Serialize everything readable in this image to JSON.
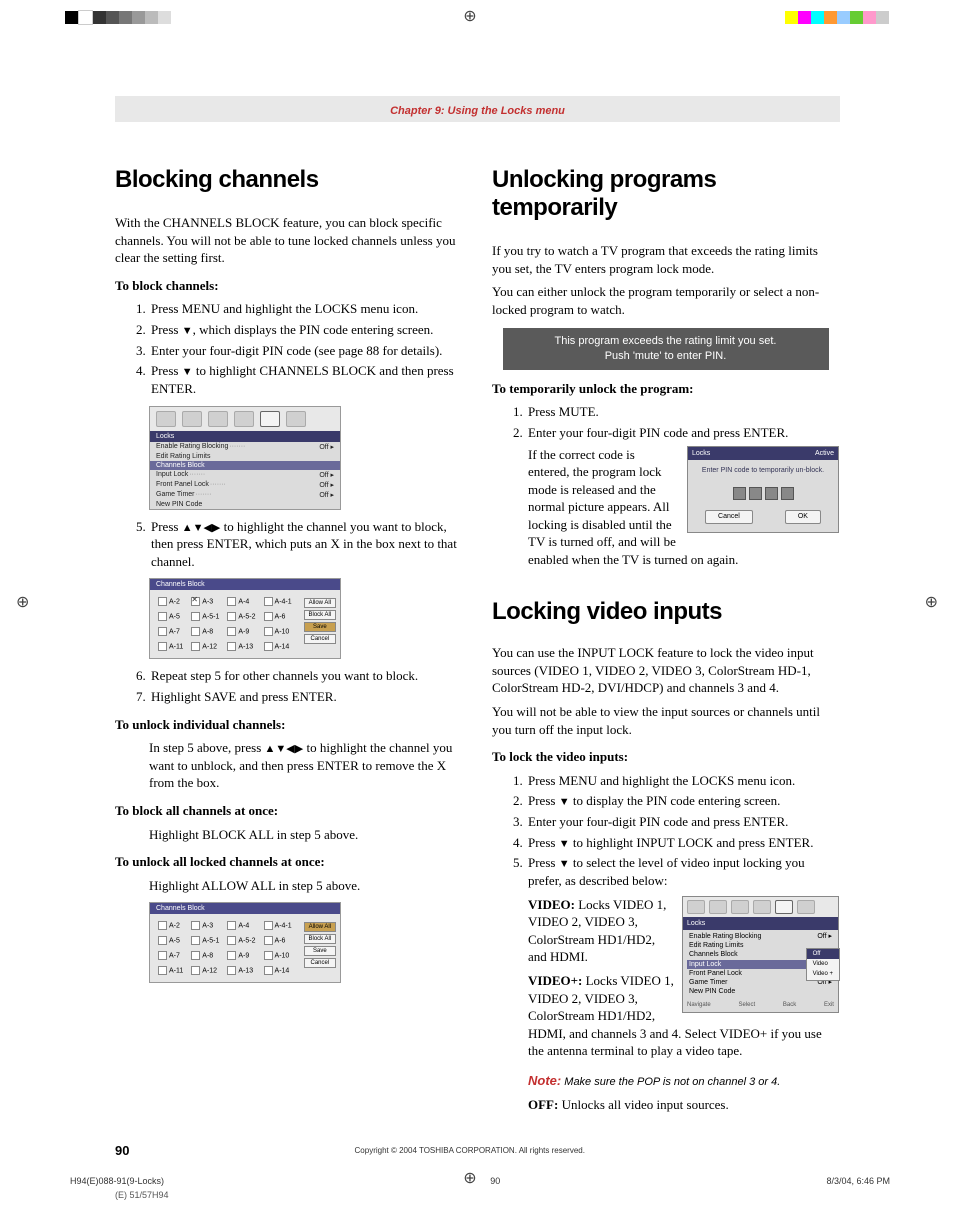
{
  "chapter": "Chapter 9: Using the Locks menu",
  "pageNumber": "90",
  "copyright": "Copyright © 2004 TOSHIBA CORPORATION. All rights reserved.",
  "printMeta": {
    "file": "H94(E)088-91(9-Locks)",
    "page": "90",
    "datetime": "8/3/04, 6:46 PM"
  },
  "trimLabel": "(E) 51/57H94",
  "left": {
    "h1": "Blocking channels",
    "intro": "With the CHANNELS BLOCK feature, you can block specific channels. You will not be able to tune locked channels unless you clear the setting first.",
    "blockHead": "To block channels:",
    "steps": {
      "s1": "Press MENU and highlight the LOCKS menu icon.",
      "s2a": "Press ",
      "s2b": ", which displays the PIN code entering screen.",
      "s3": "Enter your four-digit PIN code (see page 88 for details).",
      "s4a": "Press ",
      "s4b": " to highlight CHANNELS BLOCK and then press ENTER.",
      "s5a": "Press ",
      "s5b": " to highlight the channel you want to block, then press ENTER, which puts an X in the box next to that channel.",
      "s6": "Repeat step 5 for other channels you want to block.",
      "s7": "Highlight SAVE and press ENTER."
    },
    "unlockIndHead": "To unlock individual channels:",
    "unlockIndBody1": "In step 5 above, press ",
    "unlockIndBody2": " to highlight the channel you want to unblock, and then press ENTER to remove the X from the box.",
    "blockAllHead": "To block all channels at once:",
    "blockAllBody": "Highlight BLOCK ALL in step 5 above.",
    "unlockAllHead": "To unlock all locked channels at once:",
    "unlockAllBody": "Highlight ALLOW ALL in step 5 above.",
    "menuShot": {
      "title": "Locks",
      "rows": {
        "r1": {
          "label": "Enable Rating Blocking",
          "val": "Off ▸"
        },
        "r2": {
          "label": "Edit Rating Limits",
          "val": ""
        },
        "r3": {
          "label": "Channels Block",
          "val": ""
        },
        "r4": {
          "label": "Input Lock",
          "val": "Off ▸"
        },
        "r5": {
          "label": "Front Panel Lock",
          "val": "Off ▸"
        },
        "r6": {
          "label": "Game Timer",
          "val": "Off ▸"
        },
        "r7": {
          "label": "New PIN Code",
          "val": ""
        }
      }
    },
    "cb1": {
      "title": "Channels Block",
      "btns": {
        "allow": "Allow All",
        "block": "Block All",
        "save": "Save",
        "cancel": "Cancel"
      },
      "cells": {
        "r1c1": "A-2",
        "r1c2": "A-3",
        "r1c3": "A-4",
        "r1c4": "A-4-1",
        "r2c1": "A-5",
        "r2c2": "A-5-1",
        "r2c3": "A-5-2",
        "r2c4": "A-6",
        "r3c1": "A-7",
        "r3c2": "A-8",
        "r3c3": "A-9",
        "r3c4": "A-10",
        "r4c1": "A-11",
        "r4c2": "A-12",
        "r4c3": "A-13",
        "r4c4": "A-14"
      },
      "hl": "save"
    },
    "cb2": {
      "title": "Channels Block",
      "btns": {
        "allow": "Allow All",
        "block": "Block All",
        "save": "Save",
        "cancel": "Cancel"
      },
      "cells": {
        "r1c1": "A-2",
        "r1c2": "A-3",
        "r1c3": "A-4",
        "r1c4": "A-4-1",
        "r2c1": "A-5",
        "r2c2": "A-5-1",
        "r2c3": "A-5-2",
        "r2c4": "A-6",
        "r3c1": "A-7",
        "r3c2": "A-8",
        "r3c3": "A-9",
        "r3c4": "A-10",
        "r4c1": "A-11",
        "r4c2": "A-12",
        "r4c3": "A-13",
        "r4c4": "A-14"
      },
      "hl": "allow"
    }
  },
  "right": {
    "h1": "Unlocking programs temporarily",
    "intro1": "If you try to watch a TV program that exceeds the rating limits you set, the TV enters program lock mode.",
    "intro2": "You can either unlock the program temporarily or select a non-locked program to watch.",
    "msg1": "This program exceeds the rating limit you set.",
    "msg2": "Push 'mute' to enter PIN.",
    "tempHead": "To temporarily unlock the program:",
    "t1": "Press MUTE.",
    "t2": "Enter your four-digit PIN code and press ENTER.",
    "t2body": "If the correct code is entered, the program lock mode is released and the normal picture appears. All locking is disabled until the TV is turned off, and will be enabled when the TV is turned on again.",
    "pinDialog": {
      "title": "Locks",
      "status": "Active",
      "body": "Enter PIN code to temporarily un-block.",
      "cancel": "Cancel",
      "ok": "OK"
    },
    "h2": "Locking video inputs",
    "lv1": "You can use the INPUT LOCK feature to lock the video input sources (VIDEO 1, VIDEO 2, VIDEO 3, ColorStream HD-1, ColorStream HD-2, DVI/HDCP) and channels 3 and 4.",
    "lv2": "You will not be able to view the input sources or channels until you turn off the input lock.",
    "lockHead": "To lock the video inputs:",
    "l1": "Press MENU and highlight the LOCKS menu icon.",
    "l2a": "Press ",
    "l2b": " to display the PIN code entering screen.",
    "l3": "Enter your four-digit PIN code and press ENTER.",
    "l4a": "Press ",
    "l4b": " to highlight INPUT LOCK and press ENTER.",
    "l5a": "Press ",
    "l5b": " to select the level of video input locking you prefer, as described below:",
    "videoLabel": "VIDEO:",
    "videoBody": " Locks VIDEO 1, VIDEO 2, VIDEO 3, ColorStream HD1/HD2, and HDMI.",
    "videoPlusLabel": "VIDEO+:",
    "videoPlusBody": " Locks VIDEO 1, VIDEO 2, VIDEO 3, ColorStream HD1/HD2, HDMI, and channels 3 and 4. Select VIDEO+ if you use the antenna terminal to play a video tape.",
    "noteLabel": "Note:",
    "noteBody": " Make sure the POP is not on channel 3 or 4.",
    "offLabel": "OFF:",
    "offBody": " Unlocks all video input sources.",
    "locksShot": {
      "title": "Locks",
      "rows": {
        "r1": {
          "label": "Enable Rating Blocking",
          "val": "Off ▸"
        },
        "r2": {
          "label": "Edit Rating Limits",
          "val": ""
        },
        "r3": {
          "label": "Channels Block",
          "val": ""
        },
        "r4": {
          "label": "Input Lock",
          "val": "Off ▸"
        },
        "r5": {
          "label": "Front Panel Lock",
          "val": "Off ▸"
        },
        "r6": {
          "label": "Game Timer",
          "val": "Off ▸"
        },
        "r7": {
          "label": "New PIN Code",
          "val": ""
        }
      },
      "flyout": {
        "o1": "Off",
        "o2": "Video",
        "o3": "Video +"
      },
      "hints": {
        "nav": "Navigate",
        "sel": "Select",
        "back": "Back",
        "exit": "Exit"
      }
    }
  }
}
